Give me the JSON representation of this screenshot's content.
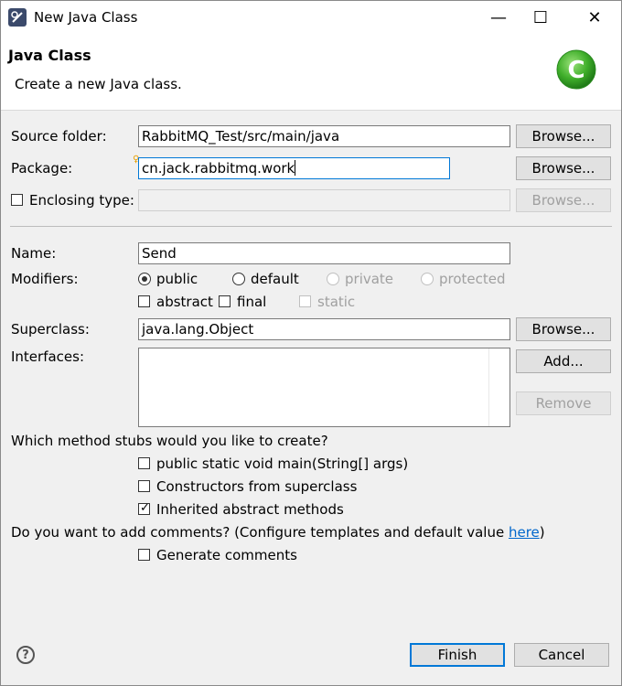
{
  "window": {
    "title": "New Java Class",
    "minimize": "—",
    "maximize": "☐",
    "close": "✕"
  },
  "header": {
    "title": "Java Class",
    "description": "Create a new Java class.",
    "logo_letter": "C"
  },
  "source_folder": {
    "label": "Source folder:",
    "value": "RabbitMQ_Test/src/main/java",
    "browse": "Browse..."
  },
  "package": {
    "label": "Package:",
    "value": "cn.jack.rabbitmq.work",
    "browse": "Browse..."
  },
  "enclosing": {
    "label": "Enclosing type:",
    "value": "",
    "browse": "Browse..."
  },
  "name": {
    "label": "Name:",
    "value": "Send"
  },
  "modifiers": {
    "label": "Modifiers:",
    "public": "public",
    "default": "default",
    "private": "private",
    "protected": "protected",
    "abstract": "abstract",
    "final": "final",
    "static": "static"
  },
  "superclass": {
    "label": "Superclass:",
    "value": "java.lang.Object",
    "browse": "Browse..."
  },
  "interfaces": {
    "label": "Interfaces:",
    "add": "Add...",
    "remove": "Remove"
  },
  "stubs": {
    "question": "Which method stubs would you like to create?",
    "main": "public static void main(String[] args)",
    "constructors": "Constructors from superclass",
    "inherited": "Inherited abstract methods"
  },
  "comments": {
    "question": "Do you want to add comments? (Configure templates and default value ",
    "link": "here",
    "question_end": ")",
    "generate": "Generate comments"
  },
  "footer": {
    "help": "?",
    "finish": "Finish",
    "cancel": "Cancel"
  },
  "colors": {
    "accent": "#0078d7",
    "logo_green": "#3fae2a",
    "link": "#0066cc"
  },
  "icons": [
    "eclipse-app-icon",
    "java-class-logo-icon",
    "help-icon",
    "checkmark-icon"
  ]
}
